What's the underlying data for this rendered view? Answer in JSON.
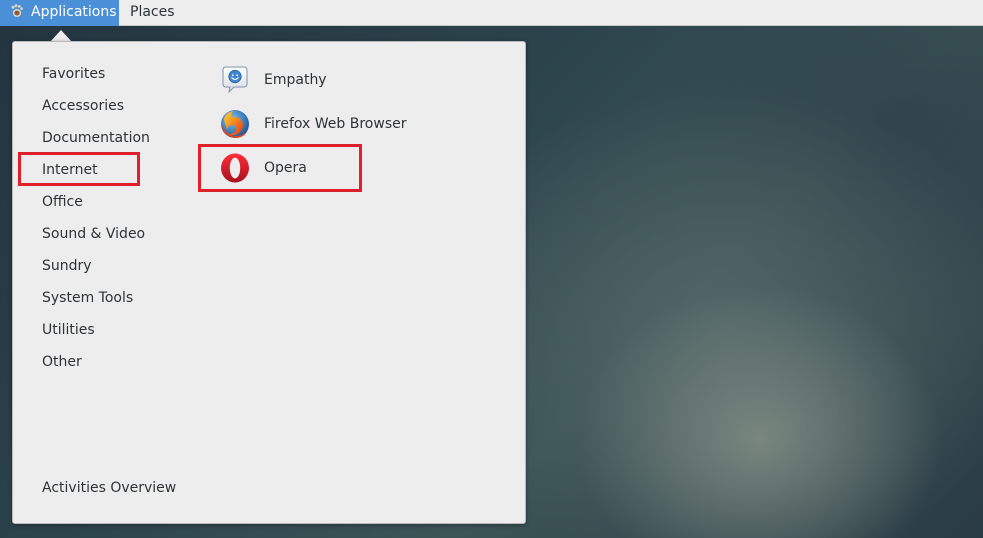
{
  "top_bar": {
    "applications_label": "Applications",
    "places_label": "Places",
    "applications_icon": "gnome-foot-icon"
  },
  "categories": [
    {
      "label": "Favorites"
    },
    {
      "label": "Accessories"
    },
    {
      "label": "Documentation"
    },
    {
      "label": "Internet",
      "highlighted": true
    },
    {
      "label": "Office"
    },
    {
      "label": "Sound & Video"
    },
    {
      "label": "Sundry"
    },
    {
      "label": "System Tools"
    },
    {
      "label": "Utilities"
    },
    {
      "label": "Other"
    }
  ],
  "activities_overview_label": "Activities Overview",
  "apps": [
    {
      "label": "Empathy",
      "icon": "empathy-icon"
    },
    {
      "label": "Firefox Web Browser",
      "icon": "firefox-icon"
    },
    {
      "label": "Opera",
      "icon": "opera-icon",
      "highlighted": true
    }
  ],
  "colors": {
    "accent": "#4a90d9",
    "highlight": "#e0212b",
    "menu_bg": "#ededed",
    "text": "#2e3436"
  }
}
